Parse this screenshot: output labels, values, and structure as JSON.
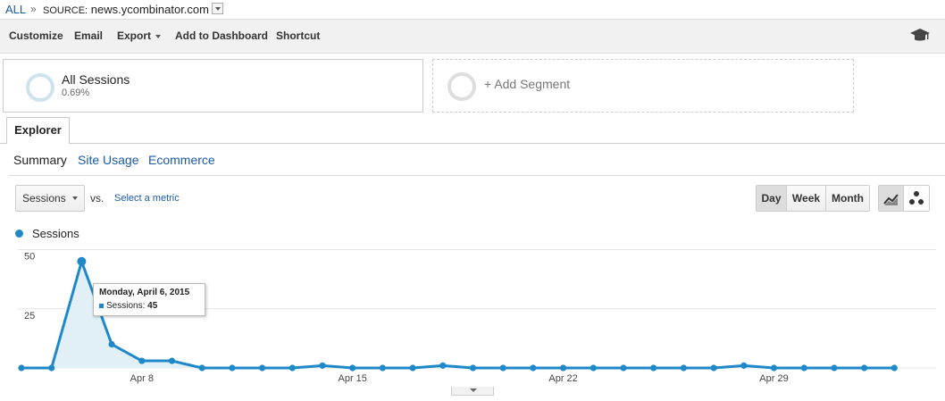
{
  "breadcrumb": {
    "all": "ALL",
    "separator": "»",
    "source_label": "SOURCE:",
    "source_value": "news.ycombinator.com"
  },
  "toolbar": {
    "customize": "Customize",
    "email": "Email",
    "export": "Export",
    "add_to_dashboard": "Add to Dashboard",
    "shortcut": "Shortcut",
    "help_icon": "graduation-cap-icon"
  },
  "segments": [
    {
      "name": "All Sessions",
      "percent": "0.69%"
    },
    {
      "add_label": "+ Add Segment"
    }
  ],
  "tabs": {
    "explorer": "Explorer"
  },
  "subtabs": {
    "summary": "Summary",
    "site_usage": "Site Usage",
    "ecommerce": "Ecommerce"
  },
  "controls": {
    "metric": "Sessions",
    "vs": "vs.",
    "select_metric": "Select a metric",
    "day": "Day",
    "week": "Week",
    "month": "Month"
  },
  "tooltip": {
    "date": "Monday, April 6, 2015",
    "metric": "Sessions:",
    "value": "45"
  },
  "colors": {
    "series": "#1f88c9",
    "area": "#e1eff7",
    "link": "#1a5aa8"
  },
  "chart_data": {
    "type": "line",
    "series": [
      {
        "name": "Sessions",
        "values": [
          0,
          0,
          45,
          10,
          3,
          3,
          0,
          0,
          0,
          0,
          1,
          0,
          0,
          0,
          1,
          0,
          0,
          0,
          0,
          0,
          0,
          0,
          0,
          0,
          1,
          0,
          0,
          0,
          0,
          0
        ]
      }
    ],
    "x": [
      "Apr 4",
      "Apr 5",
      "Apr 6",
      "Apr 7",
      "Apr 8",
      "Apr 9",
      "Apr 10",
      "Apr 11",
      "Apr 12",
      "Apr 13",
      "Apr 14",
      "Apr 15",
      "Apr 16",
      "Apr 17",
      "Apr 18",
      "Apr 19",
      "Apr 20",
      "Apr 21",
      "Apr 22",
      "Apr 23",
      "Apr 24",
      "Apr 25",
      "Apr 26",
      "Apr 27",
      "Apr 28",
      "Apr 29",
      "Apr 30",
      "May 1",
      "May 2",
      "May 3"
    ],
    "x_tick_labels": [
      "Apr 8",
      "Apr 15",
      "Apr 22",
      "Apr 29"
    ],
    "y_tick_labels": [
      "50",
      "25"
    ],
    "ylim": [
      0,
      50
    ],
    "grid": true
  }
}
